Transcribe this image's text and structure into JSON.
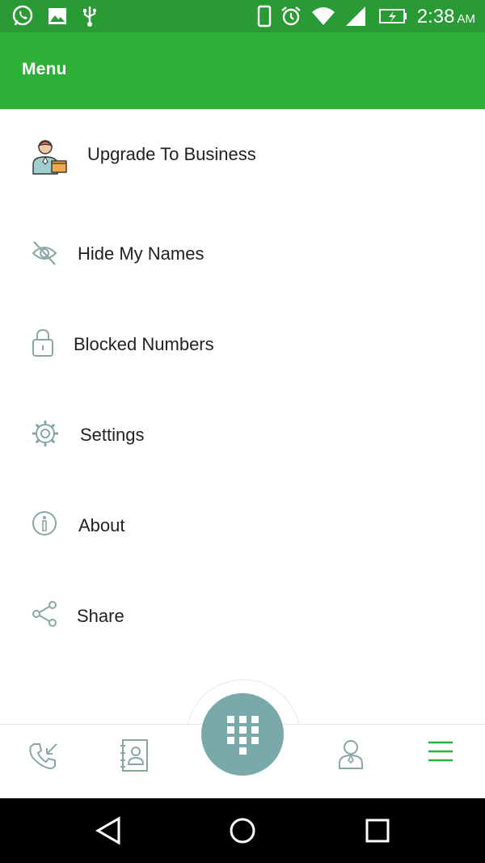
{
  "status_bar": {
    "time": "2:38",
    "ampm": "AM",
    "icons": [
      "whatsapp-icon",
      "gallery-icon",
      "usb-icon",
      "phone-icon",
      "alarm-icon",
      "wifi-icon",
      "signal-icon",
      "battery-charging-icon"
    ]
  },
  "app_bar": {
    "title": "Menu"
  },
  "menu": {
    "items": [
      {
        "label": "Upgrade To Business",
        "icon": "business-person-icon"
      },
      {
        "label": "Hide My Names",
        "icon": "eye-off-icon"
      },
      {
        "label": "Blocked Numbers",
        "icon": "lock-icon"
      },
      {
        "label": "Settings",
        "icon": "gear-icon"
      },
      {
        "label": "About",
        "icon": "info-icon"
      },
      {
        "label": "Share",
        "icon": "share-icon"
      }
    ]
  },
  "bottom_nav": {
    "items": [
      "call-log-icon",
      "contacts-book-icon",
      "dialpad-icon",
      "profile-icon",
      "menu-icon"
    ],
    "active": "menu-icon"
  },
  "colors": {
    "status_bar": "#2a9a34",
    "app_bar": "#2eb038",
    "icon_gray": "#8aa7a8",
    "fab": "#7aa9ab",
    "active_green": "#2eb038"
  }
}
